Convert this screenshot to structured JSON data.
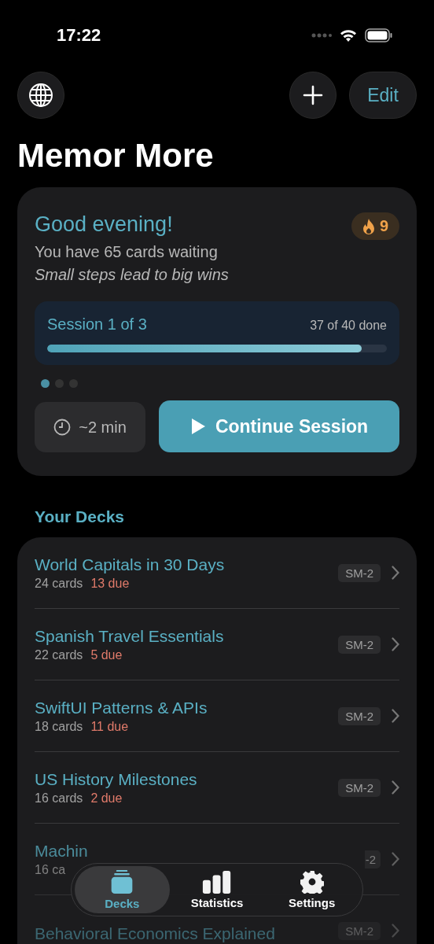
{
  "status_bar": {
    "time": "17:22"
  },
  "header": {
    "edit_label": "Edit",
    "title": "Memor More"
  },
  "greeting": {
    "title": "Good evening!",
    "streak": "9",
    "subtitle": "You have 65 cards waiting",
    "motto": "Small steps lead to big wins",
    "session": {
      "label": "Session 1 of 3",
      "progress_text": "37 of 40 done",
      "level": 0.925
    },
    "pages": [
      {
        "selected": true
      },
      {
        "selected": false
      },
      {
        "selected": false
      }
    ],
    "duration": "~2 min",
    "continue_label": "Continue Session"
  },
  "decks_heading": "Your Decks",
  "decks": [
    {
      "title": "World Capitals in 30 Days",
      "cards": "24 cards",
      "due": "13 due",
      "algorithm": "SM-2"
    },
    {
      "title": "Spanish Travel Essentials",
      "cards": "22 cards",
      "due": "5 due",
      "algorithm": "SM-2"
    },
    {
      "title": "SwiftUI Patterns & APIs",
      "cards": "18 cards",
      "due": "11 due",
      "algorithm": "SM-2"
    },
    {
      "title": "US History Milestones",
      "cards": "16 cards",
      "due": "2 due",
      "algorithm": "SM-2"
    },
    {
      "title": "Machin",
      "cards": "16 ca",
      "algorithm": "-2"
    },
    {
      "title": "Behavioral Economics Explained",
      "algorithm": "SM-2"
    }
  ],
  "tabs": [
    {
      "label": "Decks",
      "kind": "decks",
      "selected": true
    },
    {
      "label": "Statistics",
      "kind": "stats",
      "selected": false
    },
    {
      "label": "Settings",
      "kind": "settings",
      "selected": false
    }
  ]
}
